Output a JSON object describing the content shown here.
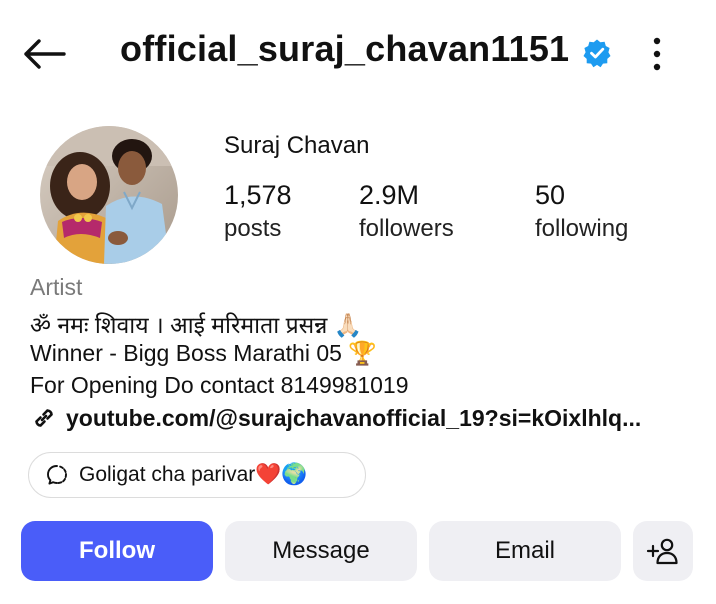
{
  "header": {
    "username": "official_suraj_chavan1151",
    "verified_icon": "verified-badge-icon",
    "back_icon": "arrow-left-icon",
    "more_icon": "more-vertical-icon"
  },
  "profile": {
    "display_name": "Suraj Chavan",
    "stats": [
      {
        "value": "1,578",
        "label": "posts"
      },
      {
        "value": "2.9M",
        "label": "followers"
      },
      {
        "value": "50",
        "label": "following"
      }
    ],
    "category": "Artist",
    "bio": [
      "ॐ नमः शिवाय । आई मरिमाता प्रसन्न 🙏🏻",
      "Winner - Bigg Boss Marathi 05 🏆",
      "For Opening Do contact 8149981019"
    ],
    "link": "youtube.com/@surajchavanofficial_19?si=kOixlhlq...",
    "thread_chip": "Goligat cha parivar❤️🌍"
  },
  "actions": {
    "follow": "Follow",
    "message": "Message",
    "email": "Email",
    "add_user_icon": "add-person-icon"
  },
  "colors": {
    "accent": "#4a5df9",
    "verified": "#1d9bf0",
    "secondary_button": "#efeff3",
    "muted_text": "#7a7a7a"
  }
}
